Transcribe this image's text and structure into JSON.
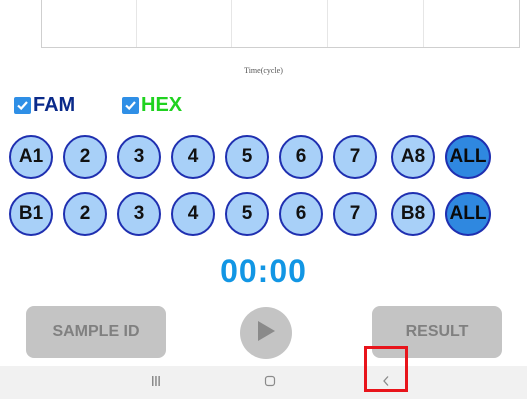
{
  "chart": {
    "x_axis_label": "Time(cycle)"
  },
  "channels": [
    {
      "label": "FAM",
      "checked": true,
      "color": "#0a2a8a"
    },
    {
      "label": "HEX",
      "checked": true,
      "color": "#1fd21f"
    }
  ],
  "row_a": {
    "wells": [
      "A1",
      "2",
      "3",
      "4",
      "5",
      "6",
      "7",
      "A8"
    ],
    "all_label": "ALL"
  },
  "row_b": {
    "wells": [
      "B1",
      "2",
      "3",
      "4",
      "5",
      "6",
      "7",
      "B8"
    ],
    "all_label": "ALL"
  },
  "timer": "00:00",
  "buttons": {
    "sample_id": "SAMPLE ID",
    "result": "RESULT",
    "play_icon": "play-icon"
  },
  "navbar": {
    "recent_icon": "recent-apps-icon",
    "home_icon": "home-icon",
    "back_icon": "back-icon"
  },
  "colors": {
    "well_fill": "#a8d0f8",
    "well_border": "#1f2fb0",
    "all_fill": "#2f88e0",
    "timer": "#1296e4",
    "highlight": "#e8141b"
  }
}
